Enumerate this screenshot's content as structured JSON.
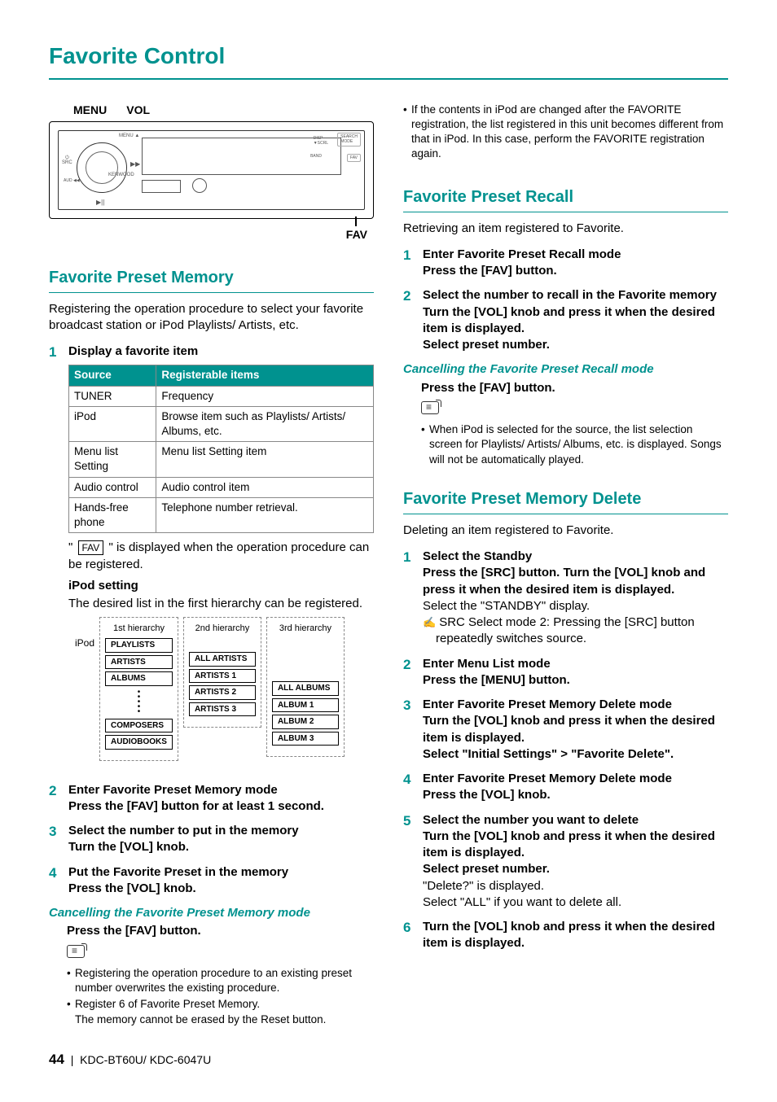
{
  "page_title": "Favorite Control",
  "panel": {
    "label_menu": "MENU",
    "label_vol": "VOL",
    "label_fav": "FAV",
    "knob_brand": "KENWOOD"
  },
  "memory": {
    "heading": "Favorite Preset Memory",
    "intro": "Registering the operation procedure to select your favorite broadcast station or iPod Playlists/ Artists, etc.",
    "step1_title": "Display a favorite item",
    "table": {
      "h1": "Source",
      "h2": "Registerable items",
      "rows": [
        {
          "c1": "TUNER",
          "c2": "Frequency"
        },
        {
          "c1": "iPod",
          "c2": "Browse item such as Playlists/ Artists/ Albums, etc."
        },
        {
          "c1": "Menu list Setting",
          "c2": "Menu list Setting item"
        },
        {
          "c1": "Audio control",
          "c2": "Audio control item"
        },
        {
          "c1": "Hands-free phone",
          "c2": "Telephone number retrieval."
        }
      ]
    },
    "fav_box": "FAV",
    "note_after": " is displayed when the operation procedure can be registered.",
    "ipod_heading": "iPod setting",
    "ipod_note": "The desired list in the first hierarchy can be registered.",
    "hier": {
      "root": "iPod",
      "col1_title": "1st hierarchy",
      "col1_items": [
        "PLAYLISTS",
        "ARTISTS",
        "ALBUMS"
      ],
      "col1_items2": [
        "COMPOSERS",
        "AUDIOBOOKS"
      ],
      "col2_title": "2nd hierarchy",
      "col2_items": [
        "ALL ARTISTS",
        "ARTISTS 1",
        "ARTISTS 2",
        "ARTISTS 3"
      ],
      "col3_title": "3rd hierarchy",
      "col3_items": [
        "ALL ALBUMS",
        "ALBUM 1",
        "ALBUM 2",
        "ALBUM 3"
      ]
    },
    "step2_title": "Enter Favorite Preset Memory mode",
    "step2_action": "Press the [FAV] button for at least 1 second.",
    "step3_title": "Select the number to put in the memory",
    "step3_action": "Turn the [VOL] knob.",
    "step4_title": "Put the Favorite Preset in the memory",
    "step4_action": "Press the [VOL] knob.",
    "cancel_heading": "Cancelling the Favorite Preset Memory mode",
    "cancel_action": "Press the [FAV] button.",
    "bullets": [
      "Registering the operation procedure to an existing preset number overwrites the existing procedure.",
      "Register 6 of Favorite Preset Memory.\nThe memory cannot be erased by the Reset button.",
      "If the contents in iPod are changed after the FAVORITE registration, the list registered in this unit becomes different from that in iPod. In this case, perform the FAVORITE registration again."
    ]
  },
  "recall": {
    "heading": "Favorite Preset Recall",
    "intro": "Retrieving an item registered to Favorite.",
    "step1_title": "Enter Favorite Preset Recall mode",
    "step1_action": "Press the [FAV] button.",
    "step2_title": "Select the number to recall in the Favorite memory",
    "step2_action": "Turn the [VOL] knob and press it when the desired item is displayed.",
    "step2_action2": "Select preset number.",
    "cancel_heading": "Cancelling the Favorite Preset Recall mode",
    "cancel_action": "Press the [FAV] button.",
    "bullet": "When iPod is selected for the source, the list selection screen for Playlists/ Artists/ Albums, etc. is displayed. Songs will not be automatically played."
  },
  "delete": {
    "heading": "Favorite Preset Memory Delete",
    "intro": "Deleting an item registered to Favorite.",
    "s1_title": "Select the Standby",
    "s1_action": "Press the [SRC] button. Turn the [VOL] knob and press it when the desired item is displayed.",
    "s1_note": "Select the \"STANDBY\" display.",
    "s1_pencil": "SRC Select mode 2: Pressing the [SRC] button repeatedly switches source.",
    "s2_title": "Enter Menu List mode",
    "s2_action": "Press the [MENU] button.",
    "s3_title": "Enter Favorite Preset Memory Delete mode",
    "s3_action": "Turn the [VOL] knob and press it when the desired item is displayed.",
    "s3_action2a": "Select \"Initial Settings\"",
    "s3_action2b": "\"Favorite Delete\".",
    "s4_title": "Enter Favorite Preset Memory Delete mode",
    "s4_action": "Press the [VOL] knob.",
    "s5_title": "Select the number you want to delete",
    "s5_action": "Turn the [VOL] knob and press it when the desired item is displayed.",
    "s5_action2": "Select preset number.",
    "s5_note1": "\"Delete?\" is displayed.",
    "s5_note2": "Select \"ALL\" if you want to delete all.",
    "s6_title": "Turn the [VOL] knob and press it when the desired item is displayed."
  },
  "footer": {
    "page": "44",
    "sep": "|",
    "model": "KDC-BT60U/ KDC-6047U"
  }
}
